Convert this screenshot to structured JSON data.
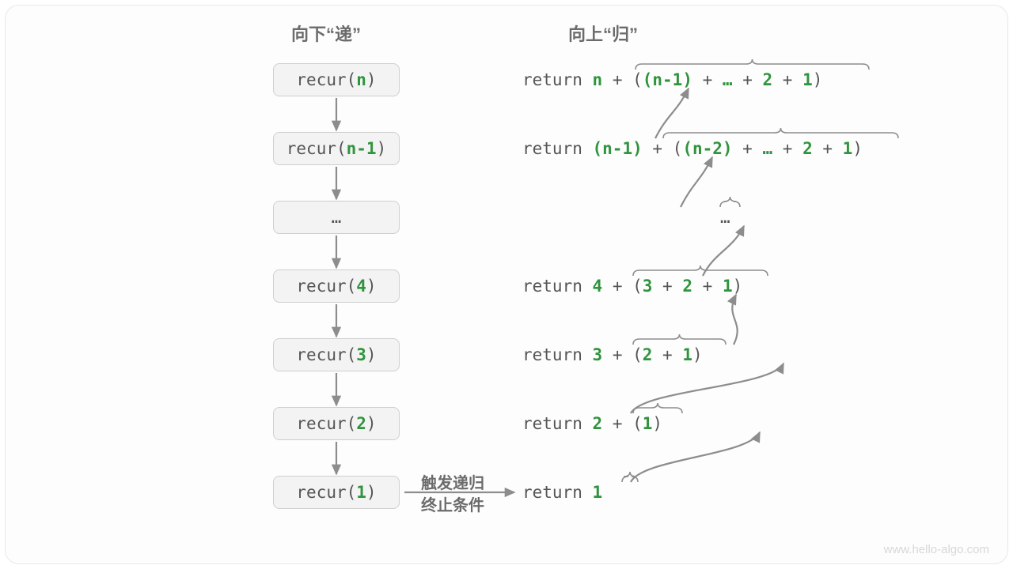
{
  "headings": {
    "down": "向下“递”",
    "up": "向上“归”"
  },
  "calls": {
    "prefix": "recur(",
    "suffix": ")",
    "args": [
      "n",
      "n-1",
      "…",
      "4",
      "3",
      "2",
      "1"
    ]
  },
  "returns": {
    "kw": "return",
    "rows": [
      {
        "parts": [
          "n",
          " + (",
          "(n-1)",
          " + ",
          "…",
          " + ",
          "2",
          " + ",
          "1",
          ")"
        ],
        "hi": [
          0,
          2,
          4,
          6,
          8
        ]
      },
      {
        "parts": [
          "(n-1)",
          " + (",
          "(n-2)",
          " + ",
          "…",
          " + ",
          "2",
          " + ",
          "1",
          ")"
        ],
        "hi": [
          0,
          2,
          4,
          6,
          8
        ]
      },
      {
        "parts": [
          "…"
        ],
        "hi": []
      },
      {
        "parts": [
          "4",
          " + (",
          "3",
          " + ",
          "2",
          " + ",
          "1",
          ")"
        ],
        "hi": [
          0,
          2,
          4,
          6
        ]
      },
      {
        "parts": [
          "3",
          " + (",
          "2",
          " + ",
          "1",
          ")"
        ],
        "hi": [
          0,
          2,
          4
        ]
      },
      {
        "parts": [
          "2",
          " + (",
          "1",
          ")"
        ],
        "hi": [
          0,
          2
        ]
      },
      {
        "parts": [
          "1"
        ],
        "hi": [
          0
        ]
      }
    ]
  },
  "note": {
    "line1": "触发递归",
    "line2": "终止条件"
  },
  "watermark": "www.hello-algo.com",
  "chart_data": {
    "type": "table",
    "title": "Recursion call/return flow",
    "left_heading": "向下“递”",
    "right_heading": "向上“归”",
    "calls": [
      "recur(n)",
      "recur(n-1)",
      "…",
      "recur(4)",
      "recur(3)",
      "recur(2)",
      "recur(1)"
    ],
    "returns": [
      "return n + ((n-1) + … + 2 + 1)",
      "return (n-1) + ((n-2) + … + 2 + 1)",
      "…",
      "return 4 + (3 + 2 + 1)",
      "return 3 + (2 + 1)",
      "return 2 + (1)",
      "return 1"
    ],
    "base_case_note": "触发递归 终止条件",
    "base_case_arrow": "recur(1) → return 1"
  }
}
